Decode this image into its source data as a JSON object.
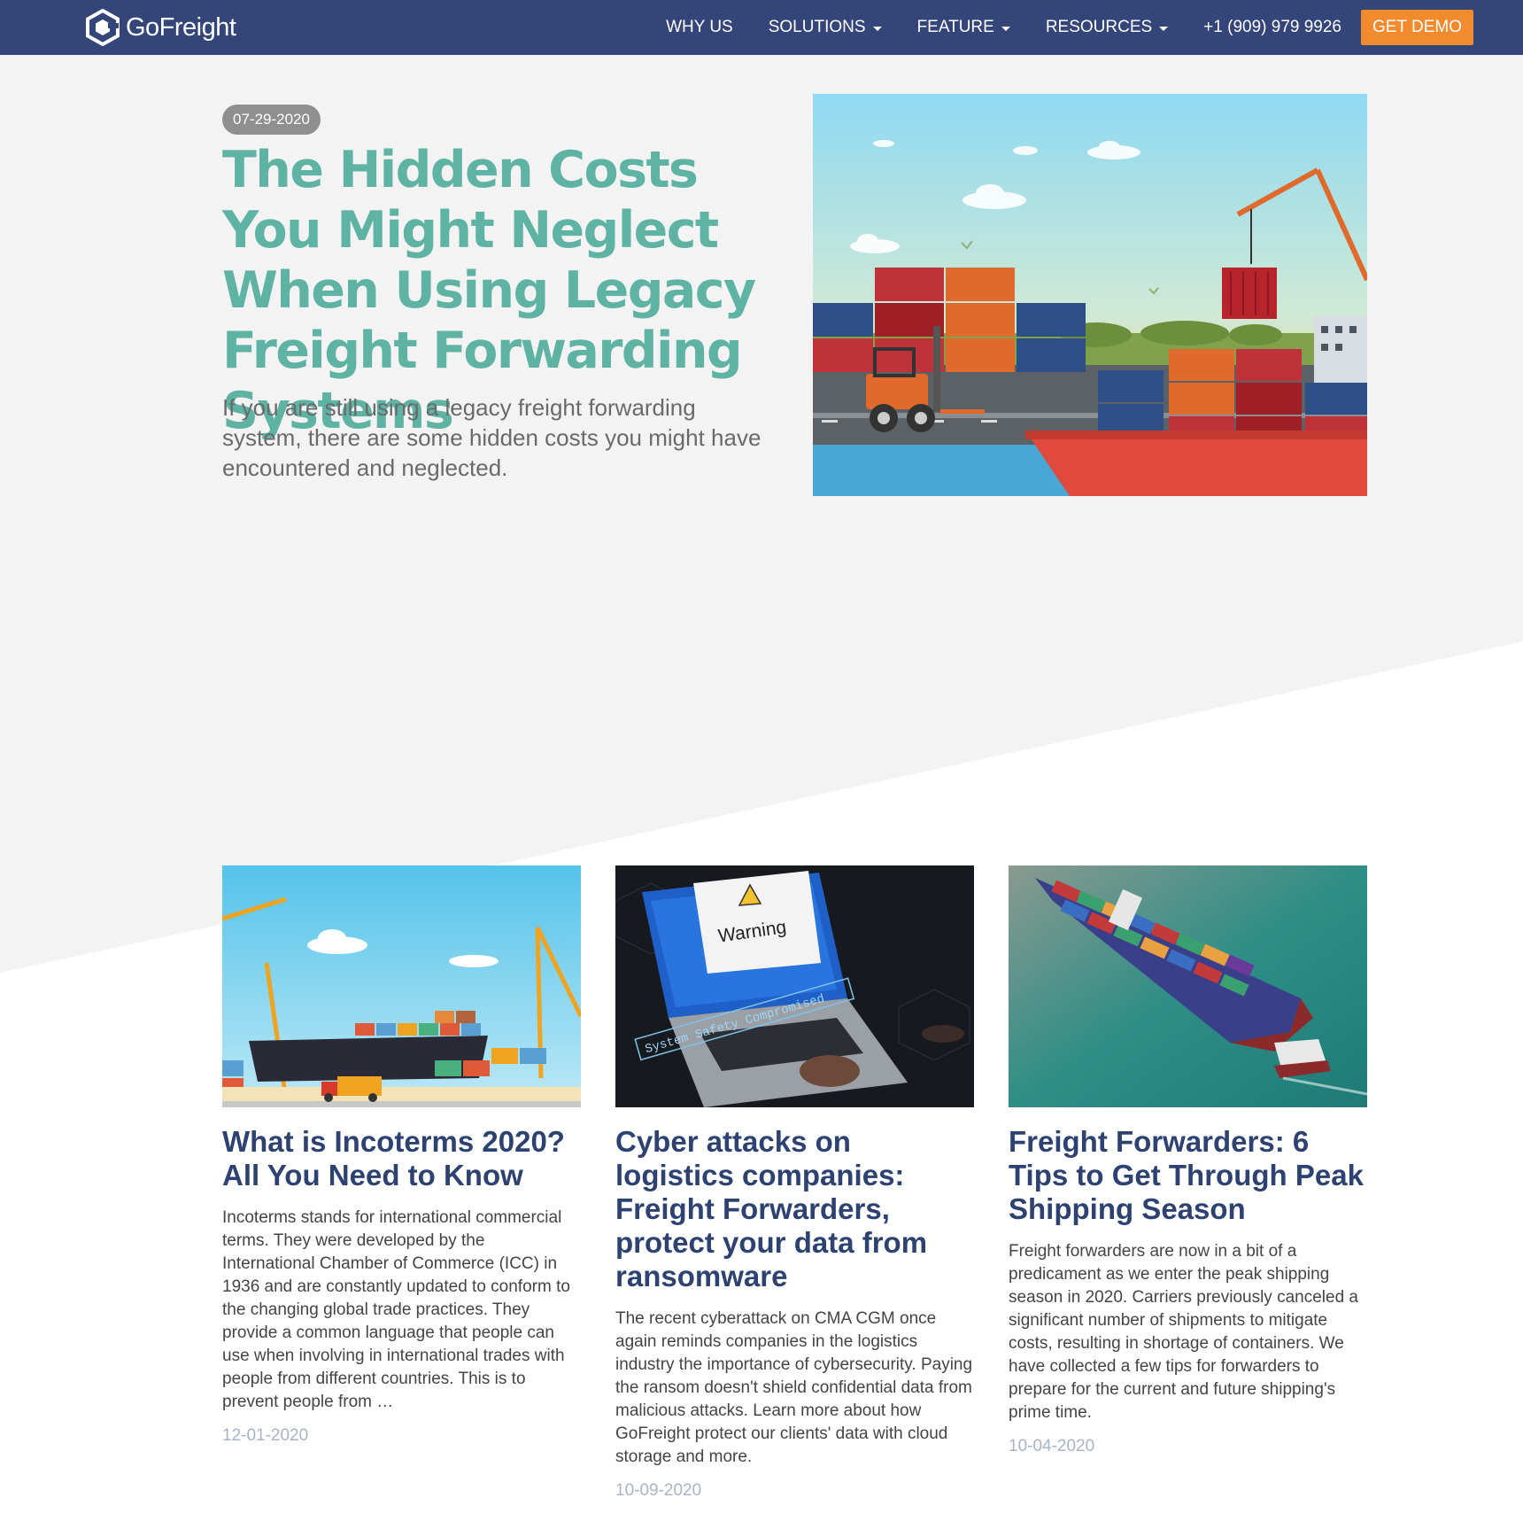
{
  "nav": {
    "logo_text": "GoFreight",
    "items": [
      {
        "label": "WHY US",
        "dropdown": false
      },
      {
        "label": "SOLUTIONS",
        "dropdown": true
      },
      {
        "label": "FEATURE",
        "dropdown": true
      },
      {
        "label": "RESOURCES",
        "dropdown": true
      }
    ],
    "phone": "+1 (909) 979 9926",
    "cta": "GET DEMO"
  },
  "hero": {
    "date": "07-29-2020",
    "title": "The Hidden Costs You Might Neglect When Using Legacy Freight Forwarding Systems",
    "subtitle": "If you are still using a legacy freight forwarding system, there are some hidden costs you might have encountered and neglected."
  },
  "articles": [
    {
      "title": "What is Incoterms 2020? All You Need to Know",
      "excerpt": "Incoterms stands for international commercial terms. They were developed by the International Chamber of Commerce (ICC) in 1936 and are constantly updated to conform to the changing global trade practices. They provide a common language that people can use when involving in international trades with people from different countries. This is to prevent people from …",
      "date": "12-01-2020"
    },
    {
      "title": "Cyber attacks on logistics companies: Freight Forwarders, protect your data from ransomware",
      "excerpt": "The recent cyberattack on CMA CGM once again reminds companies in the logistics industry the importance of cybersecurity. Paying the ransom doesn't shield confidential data from malicious attacks. Learn more about how GoFreight protect our clients' data with cloud storage and more.",
      "date": "10-09-2020",
      "image_text": {
        "warning": "Warning",
        "banner": "System Safety Compromised"
      }
    },
    {
      "title": "Freight Forwarders: 6 Tips to Get Through Peak Shipping Season",
      "excerpt": "Freight forwarders are now in a bit of a predicament as we enter the peak shipping season in 2020. Carriers previously canceled a significant number of shipments to mitigate costs, resulting in shortage of containers. We have collected a few tips for forwarders to prepare for the current and future shipping's prime time.",
      "date": "10-04-2020"
    }
  ],
  "colors": {
    "navbar": "#34457a",
    "cta": "#f28a2e",
    "hero_title": "#5eb3a3",
    "card_title": "#2e4271",
    "date_pill": "#8f8f8f"
  }
}
